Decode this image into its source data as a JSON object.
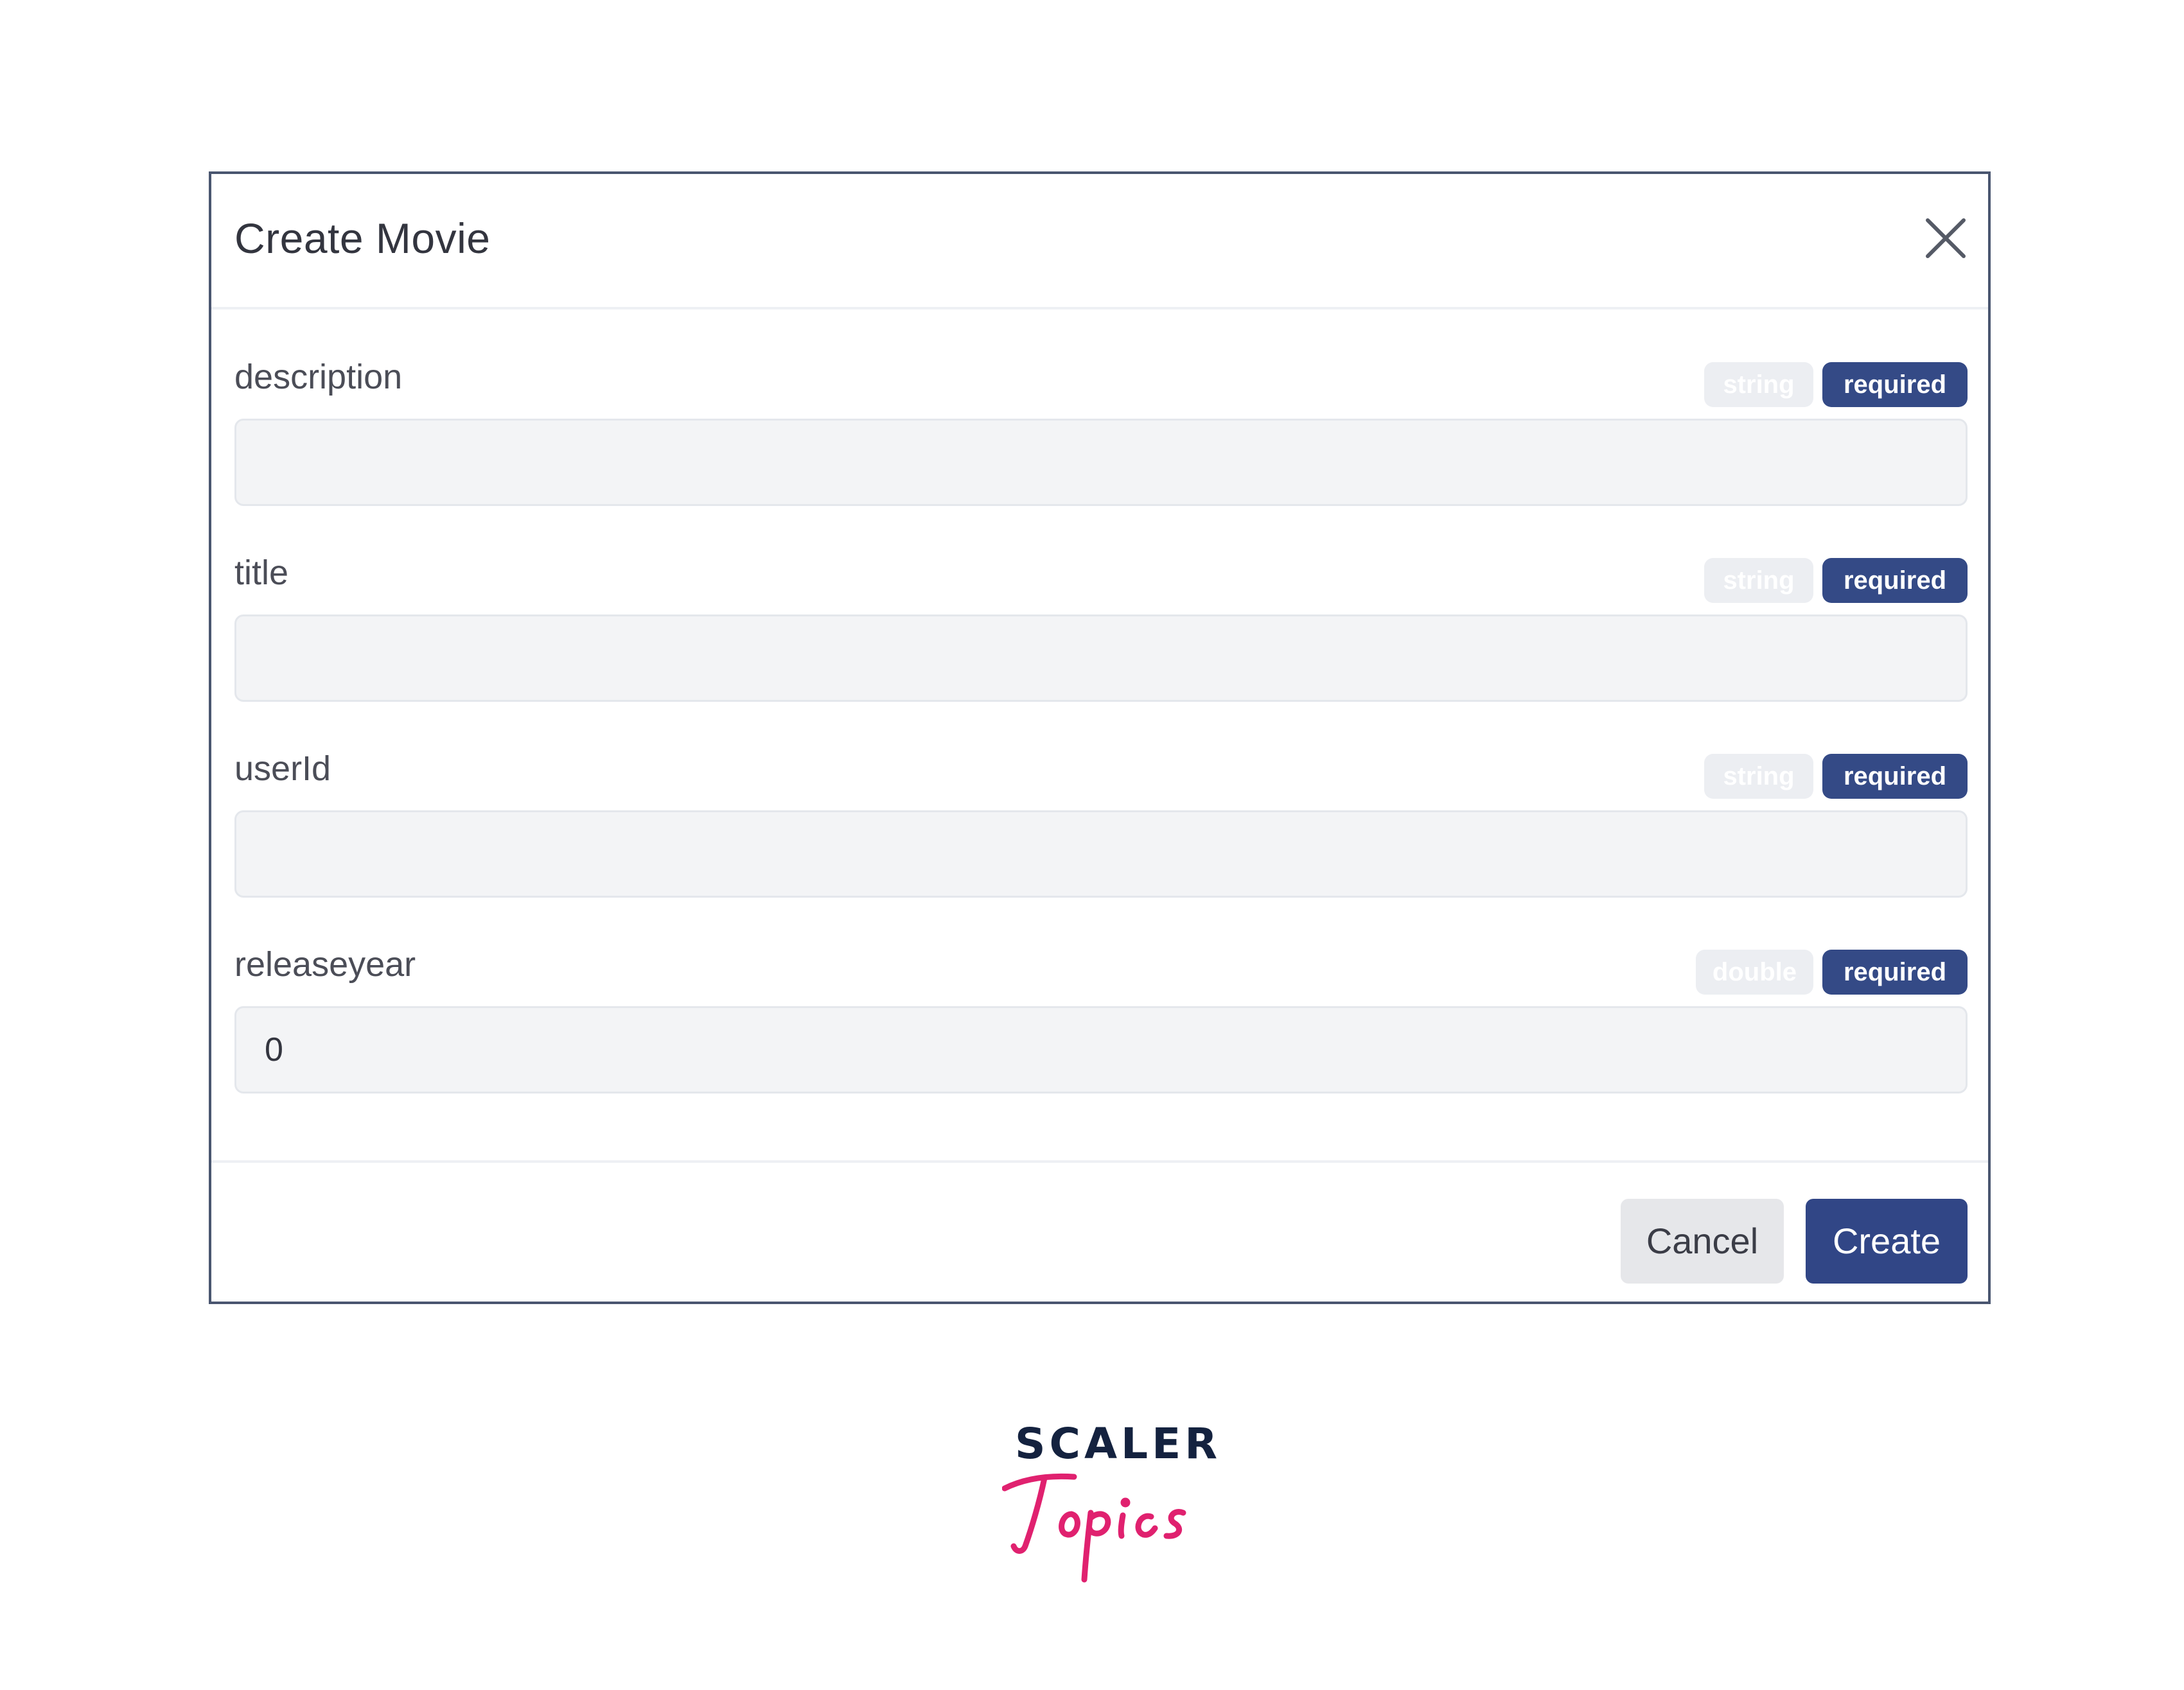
{
  "modal": {
    "title": "Create Movie",
    "close_icon": "close-icon",
    "fields": [
      {
        "label": "description",
        "type_badge": "string",
        "required_badge": "required",
        "value": ""
      },
      {
        "label": "title",
        "type_badge": "string",
        "required_badge": "required",
        "value": ""
      },
      {
        "label": "userId",
        "type_badge": "string",
        "required_badge": "required",
        "value": ""
      },
      {
        "label": "releaseyear",
        "type_badge": "double",
        "required_badge": "required",
        "value": "0"
      }
    ],
    "footer": {
      "cancel_label": "Cancel",
      "create_label": "Create"
    }
  },
  "logo": {
    "wordmark": "SCALER",
    "script": "Topics"
  },
  "colors": {
    "modal_border": "#4a5670",
    "required_badge": "#344a86",
    "type_badge": "#eceef2",
    "primary_button": "#314686",
    "input_background": "#f3f4f6",
    "logo_dark": "#14223f",
    "logo_pink": "#e0216f"
  }
}
